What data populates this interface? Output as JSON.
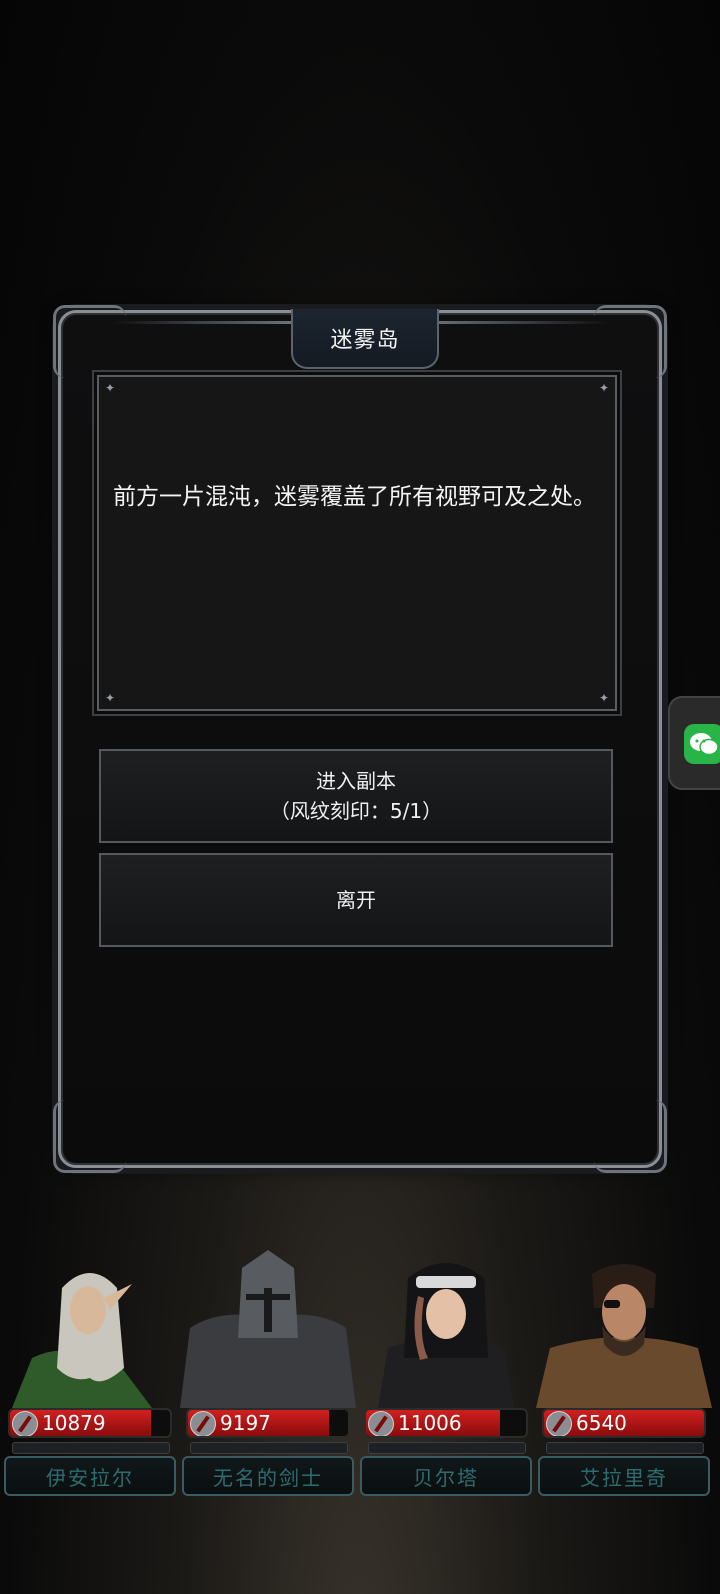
{
  "dialog": {
    "title": "迷雾岛",
    "story": "前方一片混沌，迷雾覆盖了所有视野可及之处。",
    "enter_label": "进入副本",
    "enter_cost": "（风纹刻印：5/1）",
    "leave_label": "离开"
  },
  "side_button": {
    "icon": "chat-icon"
  },
  "heroes": [
    {
      "name": "伊安拉尔",
      "hp": "10879",
      "hp_fill": 0.88,
      "style": "elf"
    },
    {
      "name": "无名的剑士",
      "hp": "9197",
      "hp_fill": 0.88,
      "style": "knight"
    },
    {
      "name": "贝尔塔",
      "hp": "11006",
      "hp_fill": 0.84,
      "style": "nun"
    },
    {
      "name": "艾拉里奇",
      "hp": "6540",
      "hp_fill": 1.0,
      "style": "rogue"
    }
  ],
  "colors": {
    "hp_red": "#c81a1a",
    "frame": "#8a8f96",
    "name_teal": "#2f6c6f"
  }
}
